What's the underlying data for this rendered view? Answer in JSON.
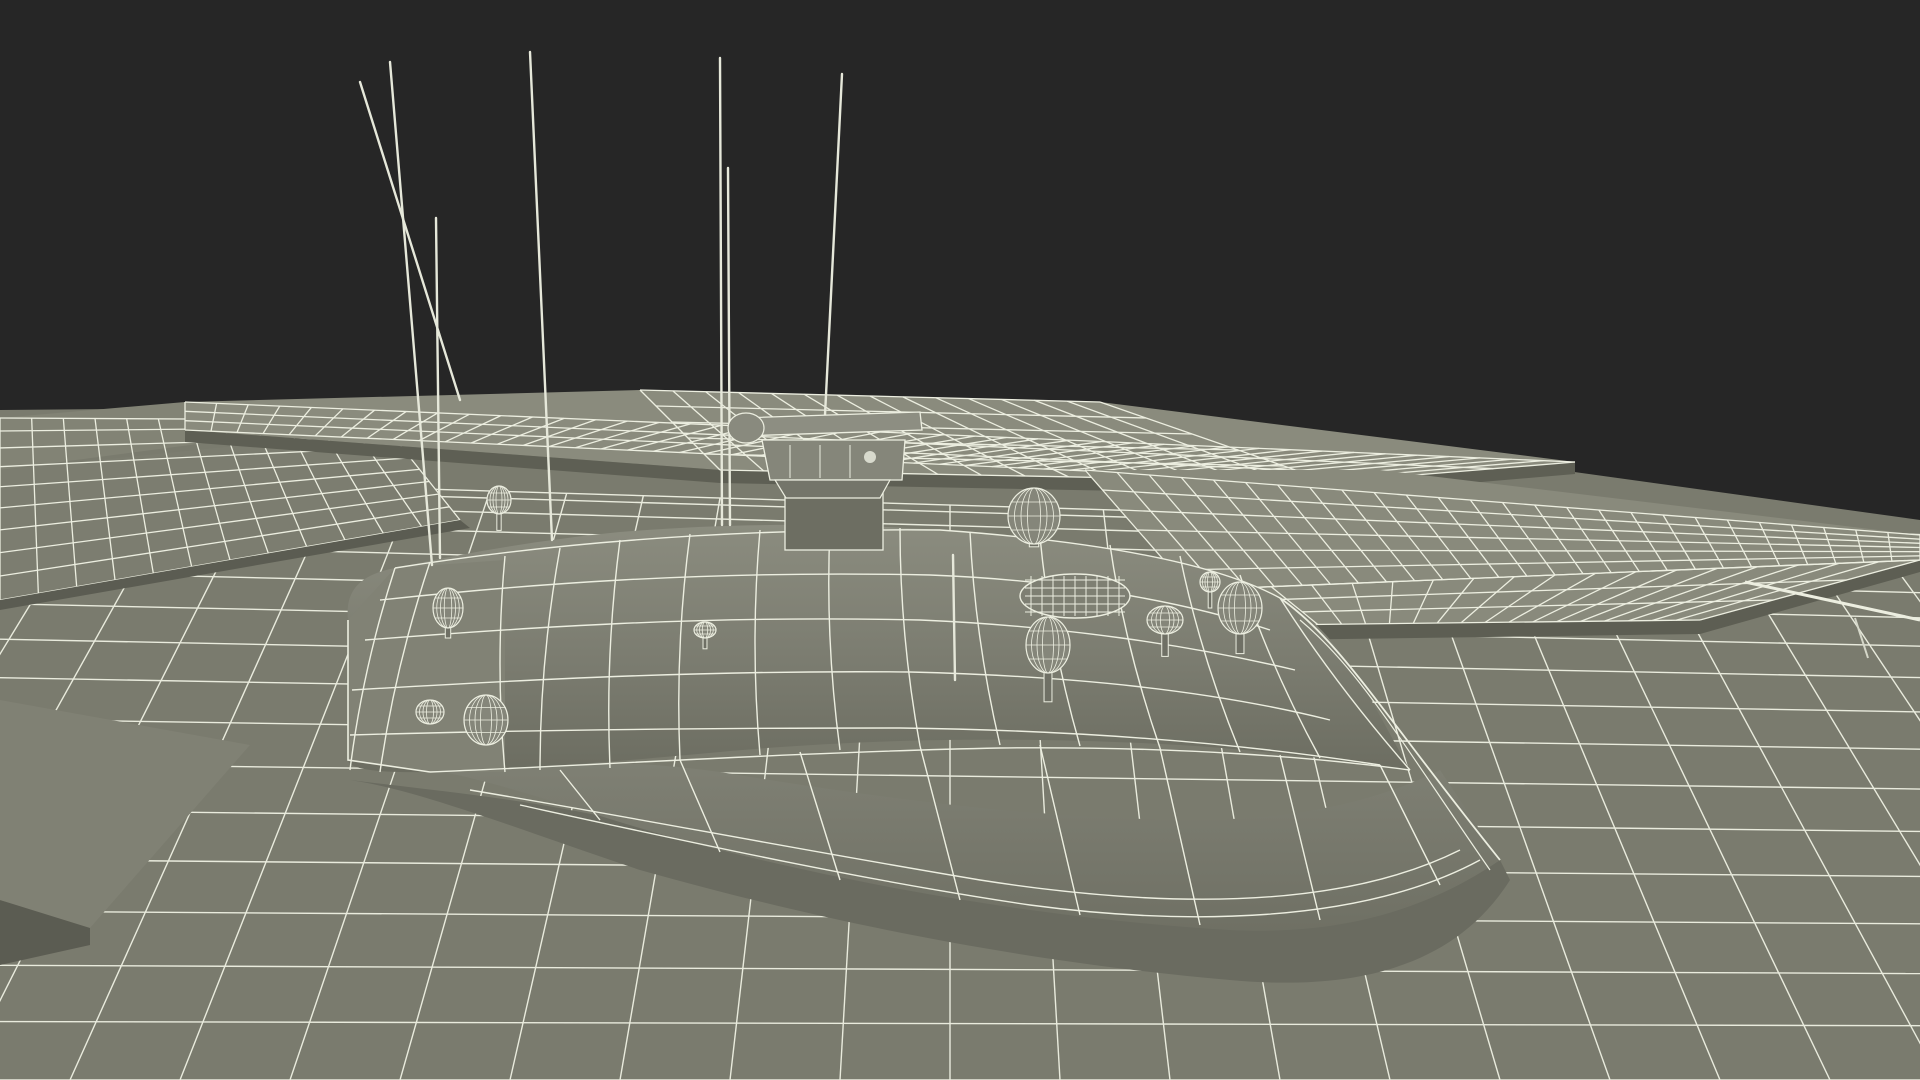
{
  "scene": {
    "subject": "wireframe-render",
    "colors": {
      "background": "#262626",
      "surface": "#797a6d",
      "surface_dark": "#67685c",
      "surface_light": "#8a8b7e",
      "panel_top": "#898a7c",
      "panel_side": "#5d5e53",
      "wire": "#eceee0",
      "wire_faint": "#d5d7c9"
    }
  }
}
